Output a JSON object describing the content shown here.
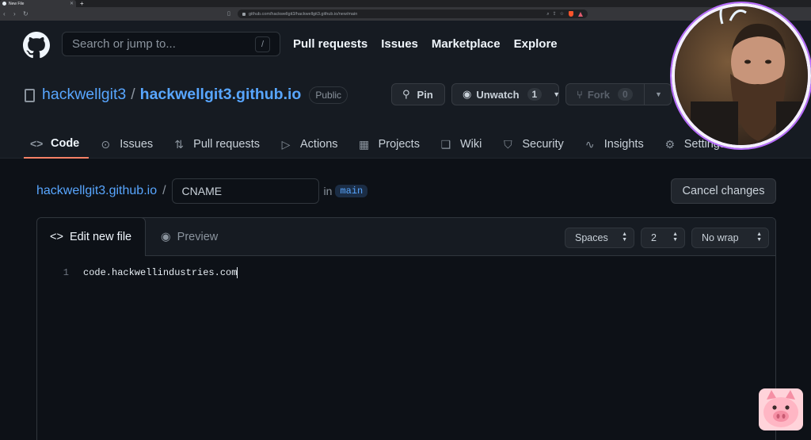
{
  "browser": {
    "tab_title": "New File",
    "url": "github.com/hackwellgit3/hackwellgit3.github.io/new/main",
    "colors": {
      "tabstrip": "#202124",
      "toolbar": "#35363a"
    }
  },
  "header": {
    "search_placeholder": "Search or jump to...",
    "search_shortcut": "/",
    "nav": [
      "Pull requests",
      "Issues",
      "Marketplace",
      "Explore"
    ]
  },
  "repo": {
    "owner": "hackwellgit3",
    "separator": "/",
    "name": "hackwellgit3.github.io",
    "visibility": "Public",
    "pin_label": "Pin",
    "watch_label": "Unwatch",
    "watch_count": "1",
    "fork_label": "Fork",
    "fork_count": "0",
    "tabs": [
      "Code",
      "Issues",
      "Pull requests",
      "Actions",
      "Projects",
      "Wiki",
      "Security",
      "Insights",
      "Settings"
    ],
    "tab_icons": [
      "code-icon",
      "issue-icon",
      "pull-request-icon",
      "play-icon",
      "table-icon",
      "book-icon",
      "shield-icon",
      "graph-icon",
      "gear-icon"
    ],
    "active_tab": "Code"
  },
  "edit": {
    "breadcrumb_repo": "hackwellgit3.github.io",
    "breadcrumb_slash": "/",
    "filename": "CNAME",
    "in_label": "in",
    "branch": "main",
    "cancel_label": "Cancel changes",
    "tab_edit": "Edit new file",
    "tab_preview": "Preview",
    "indent_mode": "Spaces",
    "indent_size": "2",
    "wrap_mode": "No wrap",
    "lines": [
      {
        "number": "1",
        "text": "code.hackwellindustries.com"
      }
    ]
  },
  "colors": {
    "page_bg": "#0d1117",
    "header_bg": "#161b22",
    "link": "#58a6ff",
    "active_tab_underline": "#f78166",
    "border": "#30363d"
  }
}
